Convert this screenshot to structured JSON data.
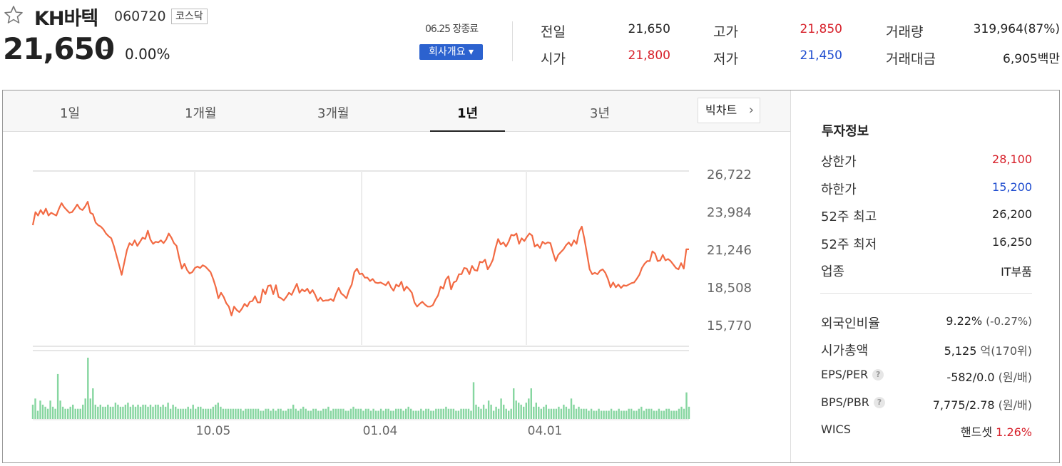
{
  "stock": {
    "name": "KH바텍",
    "code": "060720",
    "market": "코스닥",
    "price": "21,650",
    "change_sign": "–",
    "change_pct": "0.00%",
    "close_time": "06.25 장종료",
    "info_button": "회사개요 ▾"
  },
  "quote": {
    "prev_label": "전일",
    "prev_value": "21,650",
    "open_label": "시가",
    "open_value": "21,800",
    "high_label": "고가",
    "high_value": "21,850",
    "low_label": "저가",
    "low_value": "21,450",
    "volume_label": "거래량",
    "volume_value": "319,964(87%)",
    "amount_label": "거래대금",
    "amount_value": "6,905백만"
  },
  "tabs": [
    "1일",
    "1개월",
    "3개월",
    "1년",
    "3년"
  ],
  "active_tab": "1년",
  "bigchart_label": "빅차트",
  "colors": {
    "line": "#f26a43",
    "volume": "#86d6a0",
    "up": "#d7202a",
    "down": "#1d4bcf",
    "accent": "#2c62cf"
  },
  "invest": {
    "title": "투자정보",
    "rows": [
      {
        "label": "상한가",
        "value": "28,100"
      },
      {
        "label": "하한가",
        "value": "15,200"
      },
      {
        "label": "52주 최고",
        "value": "26,200"
      },
      {
        "label": "52주 최저",
        "value": "16,250"
      },
      {
        "label": "업종",
        "value": "IT부품"
      }
    ],
    "rows2": [
      {
        "label": "외국인비율",
        "value": "9.22%",
        "extra": "(-0.27%)"
      },
      {
        "label": "시가총액",
        "value": "5,125",
        "unit": "억",
        "extra": "(170위)"
      },
      {
        "label": "EPS/PER",
        "value": "-582/0.0",
        "unit": "(원/배)"
      },
      {
        "label": "BPS/PBR",
        "value": "7,775/2.78",
        "unit": "(원/배)"
      },
      {
        "label": "WICS",
        "value": "핸드셋",
        "extra": "1.26%"
      }
    ]
  },
  "chart_data": {
    "type": "line",
    "y_ticks": [
      "26,722",
      "23,984",
      "21,246",
      "18,508",
      "15,770"
    ],
    "y_tick_values": [
      26722,
      23984,
      21246,
      18508,
      15770
    ],
    "x_ticks": [
      "10.05",
      "01.04",
      "04.01"
    ],
    "ylim": [
      15770,
      26722
    ],
    "grid": true,
    "series": [
      {
        "values": [
          23000,
          23950,
          23700,
          24100,
          23800,
          24200,
          23700,
          23900,
          23800,
          23700,
          24200,
          24600,
          24300,
          24100,
          23900,
          23950,
          24200,
          24500,
          24200,
          24100,
          24350,
          24700,
          23900,
          23800,
          23200,
          23000,
          22900,
          22700,
          22400,
          22200,
          22050,
          21500,
          20800,
          20100,
          19400,
          20300,
          21200,
          21700,
          21550,
          21900,
          21500,
          21800,
          22100,
          22000,
          22600,
          21950,
          21650,
          21800,
          21750,
          21900,
          21700,
          21950,
          22400,
          22100,
          21700,
          21500,
          20600,
          19850,
          20200,
          19750,
          19500,
          19600,
          19900,
          20000,
          19900,
          20100,
          20000,
          19800,
          19600,
          19100,
          18500,
          17700,
          18100,
          17800,
          17350,
          17100,
          16450,
          17100,
          16850,
          16700,
          16950,
          17300,
          17100,
          17450,
          17500,
          17850,
          17400,
          17400,
          18350,
          18000,
          18600,
          18650,
          18000,
          18650,
          17800,
          17700,
          17550,
          17800,
          18100,
          17950,
          18350,
          18750,
          18100,
          18350,
          18200,
          18400,
          18050,
          18300,
          17950,
          17500,
          17750,
          17500,
          17550,
          17550,
          17650,
          17500,
          18050,
          18450,
          18050,
          17900,
          17700,
          18300,
          18700,
          19600,
          19850,
          19450,
          19500,
          19200,
          19200,
          18950,
          19100,
          18850,
          18800,
          18850,
          18750,
          18650,
          18900,
          18500,
          18250,
          18700,
          18550,
          18900,
          18250,
          18550,
          18350,
          18100,
          17400,
          17100,
          17300,
          17450,
          17250,
          17100,
          17100,
          17200,
          17600,
          17900,
          18550,
          18400,
          19050,
          19300,
          18350,
          18850,
          18950,
          19450,
          19450,
          19900,
          19850,
          19450,
          20050,
          19750,
          19700,
          20350,
          20300,
          20500,
          19800,
          20100,
          20500,
          21350,
          22000,
          21600,
          21750,
          21450,
          21800,
          22300,
          22250,
          22400,
          21650,
          22050,
          21850,
          22150,
          22400,
          22250,
          21450,
          21600,
          21350,
          21800,
          21650,
          21750,
          21700,
          21000,
          20400,
          20850,
          21050,
          21250,
          21550,
          21750,
          21500,
          21900,
          21650,
          22550,
          22900,
          22000,
          20900,
          19800,
          19450,
          19550,
          19450,
          19700,
          19800,
          19550,
          19100,
          18500,
          18850,
          18500,
          18700,
          18450,
          18650,
          18600,
          18700,
          18800,
          18850,
          19100,
          19400,
          19900,
          20200,
          20400,
          20400,
          21100,
          20950,
          20400,
          20450,
          20850,
          20450,
          20550,
          20400,
          20150,
          19900,
          19800,
          20250,
          19850,
          21250,
          21250
        ]
      }
    ],
    "volume": [
      14,
      20,
      8,
      18,
      14,
      12,
      10,
      18,
      12,
      10,
      44,
      18,
      12,
      10,
      10,
      12,
      14,
      10,
      10,
      10,
      14,
      20,
      60,
      20,
      30,
      14,
      12,
      14,
      12,
      12,
      14,
      12,
      12,
      16,
      14,
      12,
      12,
      14,
      16,
      12,
      14,
      12,
      14,
      12,
      14,
      14,
      12,
      14,
      12,
      14,
      14,
      12,
      14,
      12,
      16,
      10,
      14,
      12,
      10,
      10,
      10,
      10,
      12,
      10,
      14,
      10,
      12,
      12,
      10,
      10,
      10,
      10,
      12,
      14,
      16,
      12,
      10,
      10,
      10,
      10,
      10,
      10,
      10,
      10,
      8,
      10,
      10,
      10,
      10,
      10,
      10,
      8,
      8,
      10,
      10,
      8,
      10,
      8,
      10,
      10,
      8,
      8,
      10,
      10,
      14,
      10,
      8,
      10,
      12,
      10,
      8,
      8,
      10,
      10,
      8,
      8,
      10,
      10,
      12,
      8,
      10,
      10,
      10,
      10,
      10,
      8,
      8,
      10,
      12,
      10,
      10,
      10,
      8,
      10,
      10,
      8,
      10,
      8,
      8,
      10,
      8,
      10,
      10,
      8,
      8,
      10,
      10,
      10,
      8,
      10,
      12,
      10,
      8,
      8,
      8,
      10,
      8,
      10,
      10,
      8,
      8,
      10,
      10,
      10,
      10,
      12,
      10,
      10,
      10,
      8,
      8,
      10,
      10,
      10,
      10,
      8,
      36,
      14,
      12,
      10,
      14,
      10,
      18,
      14,
      8,
      12,
      10,
      20,
      14,
      10,
      8,
      10,
      30,
      18,
      16,
      14,
      12,
      16,
      20,
      30,
      12,
      16,
      12,
      10,
      12,
      14,
      10,
      10,
      10,
      10,
      12,
      10,
      14,
      12,
      10,
      20,
      14,
      10,
      12,
      10,
      10,
      10,
      8,
      10,
      8,
      8,
      10,
      8,
      8,
      8,
      8,
      10,
      8,
      8,
      10,
      8,
      8,
      8,
      10,
      10,
      8,
      8,
      10,
      12,
      8,
      10,
      10,
      10,
      8,
      8,
      10,
      8,
      8,
      10,
      10,
      8,
      8,
      8,
      10,
      12,
      10,
      26,
      12
    ]
  }
}
